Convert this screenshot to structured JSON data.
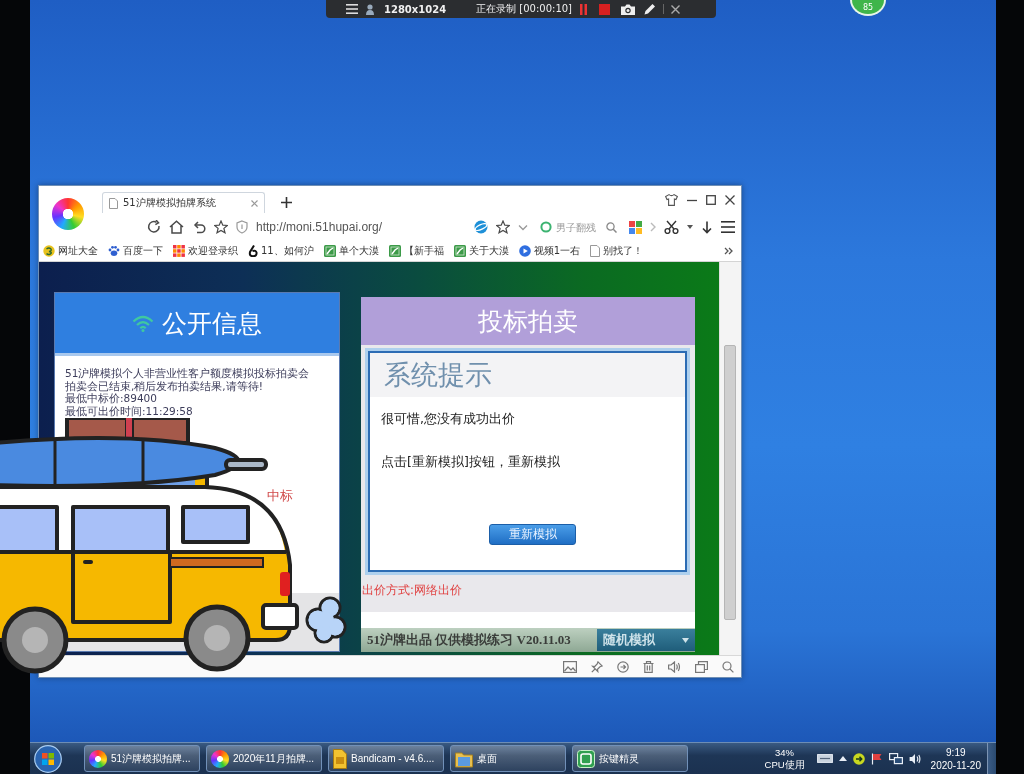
{
  "recorder": {
    "resolution": "1280x1024",
    "status": "正在录制 [00:00:10]"
  },
  "corner_badge": {
    "text": "85"
  },
  "browser": {
    "tabs": [
      {
        "title": "51沪牌模拟拍牌系统",
        "selected": true
      }
    ],
    "address": "http://moni.51hupai.org/",
    "search": {
      "placeholder": "男子翻残"
    },
    "bookmarks": [
      {
        "label": "网址大全",
        "kind": "globe"
      },
      {
        "label": "百度一下",
        "kind": "paw"
      },
      {
        "label": "欢迎登录织",
        "kind": "grid"
      },
      {
        "label": "11、如何沪",
        "kind": "mark"
      },
      {
        "label": "单个大漠",
        "kind": "sheet"
      },
      {
        "label": "【新手福",
        "kind": "sheet"
      },
      {
        "label": "关于大漠",
        "kind": "sheet"
      },
      {
        "label": "视频1一右",
        "kind": "play"
      },
      {
        "label": "别找了！",
        "kind": "page"
      }
    ]
  },
  "info_panel": {
    "title": "公开信息",
    "lines": [
      "51沪牌模拟个人非营业性客户额度模拟投标拍卖会",
      "拍卖会已结束,稍后发布拍卖结果,请等待!",
      "最低中标价:89400",
      "最低可出价时间:11:29:58"
    ],
    "note": "中标"
  },
  "bid_panel": {
    "title": "投标拍卖",
    "dialog": {
      "title": "系统提示",
      "messages": [
        "很可惜,您没有成功出价",
        "点击[重新模拟]按钮，重新模拟"
      ],
      "button": "重新模拟"
    },
    "bid_method": "出价方式:网络出价",
    "footer": {
      "credit": "51沪牌出品 仅供模拟练习 V20.11.03",
      "mode": "随机模拟"
    }
  },
  "taskbar": {
    "items": [
      {
        "label": "51沪牌模拟拍牌...",
        "kind": "browser"
      },
      {
        "label": "2020年11月拍牌...",
        "kind": "browser"
      },
      {
        "label": "Bandicam - v4.6....",
        "kind": "bandicam"
      },
      {
        "label": "桌面",
        "kind": "folder"
      },
      {
        "label": "按键精灵",
        "kind": "app"
      }
    ],
    "cpu": {
      "value": "34%",
      "label": "CPU使用"
    },
    "clock": {
      "time": "9:19",
      "date": "2020-11-20"
    }
  }
}
